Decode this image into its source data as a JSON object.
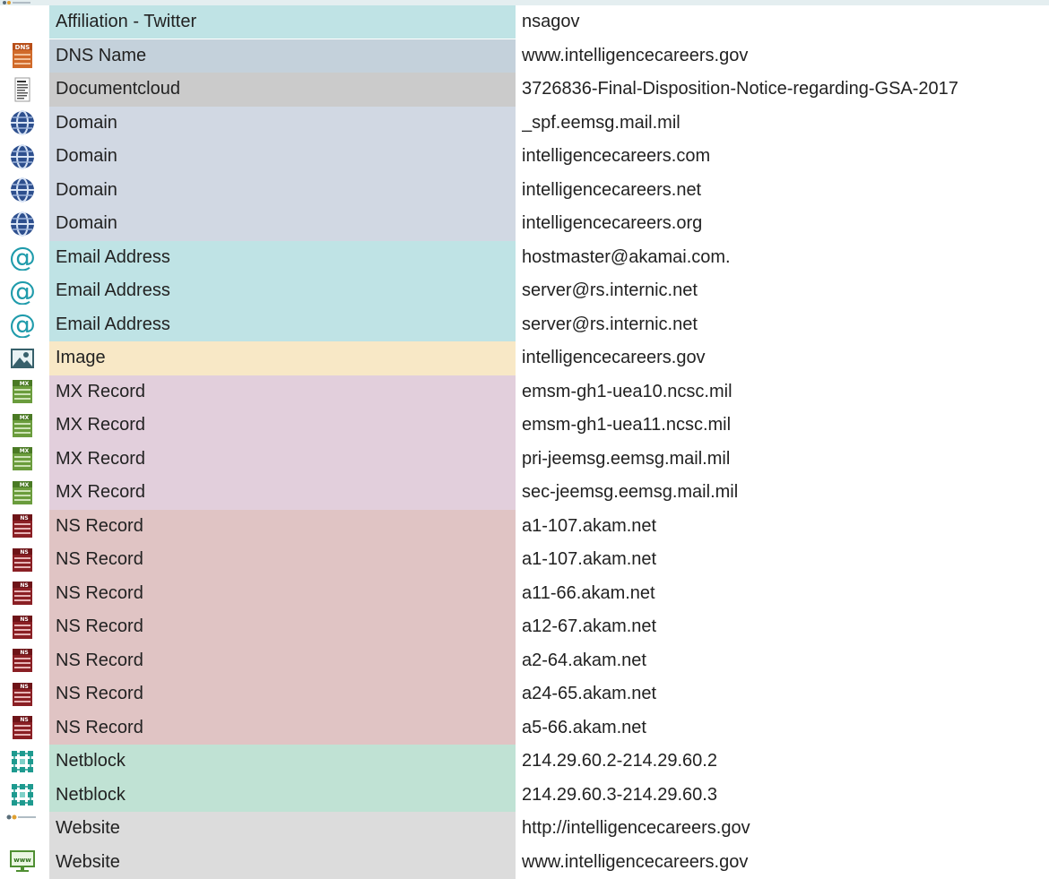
{
  "colors": {
    "twitter": "#bfe3e5",
    "dns": "#c4d1db",
    "document": "#cbcbcb",
    "domain": "#d1d8e3",
    "email": "#bfe3e5",
    "image": "#f8e8c6",
    "mx": "#e2cfdc",
    "ns": "#e0c4c4",
    "netblock": "#c0e2d4",
    "website": "#dcdcdc"
  },
  "rows": [
    {
      "icon": "twitter-affiliation-icon",
      "type": "Affiliation - Twitter",
      "value": "nsagov",
      "color": "twitter"
    },
    {
      "icon": "dns-name-icon",
      "type": "DNS Name",
      "value": "www.intelligencecareers.gov",
      "color": "dns"
    },
    {
      "icon": "document-icon",
      "type": "Documentcloud",
      "value": "3726836-Final-Disposition-Notice-regarding-GSA-2017",
      "color": "document"
    },
    {
      "icon": "globe-icon",
      "type": "Domain",
      "value": "_spf.eemsg.mail.mil",
      "color": "domain"
    },
    {
      "icon": "globe-icon",
      "type": "Domain",
      "value": "intelligencecareers.com",
      "color": "domain"
    },
    {
      "icon": "globe-icon",
      "type": "Domain",
      "value": "intelligencecareers.net",
      "color": "domain"
    },
    {
      "icon": "globe-icon",
      "type": "Domain",
      "value": "intelligencecareers.org",
      "color": "domain"
    },
    {
      "icon": "at-sign-icon",
      "type": "Email Address",
      "value": "hostmaster@akamai.com.",
      "color": "email"
    },
    {
      "icon": "at-sign-icon",
      "type": "Email Address",
      "value": "server@rs.internic.net",
      "color": "email"
    },
    {
      "icon": "at-sign-icon",
      "type": "Email Address",
      "value": "server@rs.internic.net",
      "color": "email"
    },
    {
      "icon": "image-icon",
      "type": "Image",
      "value": "intelligencecareers.gov",
      "color": "image"
    },
    {
      "icon": "mx-server-icon",
      "type": "MX Record",
      "value": "emsm-gh1-uea10.ncsc.mil",
      "color": "mx"
    },
    {
      "icon": "mx-server-icon",
      "type": "MX Record",
      "value": "emsm-gh1-uea11.ncsc.mil",
      "color": "mx"
    },
    {
      "icon": "mx-server-icon",
      "type": "MX Record",
      "value": "pri-jeemsg.eemsg.mail.mil",
      "color": "mx"
    },
    {
      "icon": "mx-server-icon",
      "type": "MX Record",
      "value": "sec-jeemsg.eemsg.mail.mil",
      "color": "mx"
    },
    {
      "icon": "ns-server-icon",
      "type": "NS Record",
      "value": "a1-107.akam.net",
      "color": "ns"
    },
    {
      "icon": "ns-server-icon",
      "type": "NS Record",
      "value": "a1-107.akam.net",
      "color": "ns"
    },
    {
      "icon": "ns-server-icon",
      "type": "NS Record",
      "value": "a11-66.akam.net",
      "color": "ns"
    },
    {
      "icon": "ns-server-icon",
      "type": "NS Record",
      "value": "a12-67.akam.net",
      "color": "ns"
    },
    {
      "icon": "ns-server-icon",
      "type": "NS Record",
      "value": "a2-64.akam.net",
      "color": "ns"
    },
    {
      "icon": "ns-server-icon",
      "type": "NS Record",
      "value": "a24-65.akam.net",
      "color": "ns"
    },
    {
      "icon": "ns-server-icon",
      "type": "NS Record",
      "value": "a5-66.akam.net",
      "color": "ns"
    },
    {
      "icon": "netblock-icon",
      "type": "Netblock",
      "value": "214.29.60.2-214.29.60.2",
      "color": "netblock"
    },
    {
      "icon": "netblock-icon",
      "type": "Netblock",
      "value": "214.29.60.3-214.29.60.3",
      "color": "netblock"
    },
    {
      "icon": "website-small-icon",
      "type": "Website",
      "value": "http://intelligencecareers.gov",
      "color": "website"
    },
    {
      "icon": "www-monitor-icon",
      "type": "Website",
      "value": "www.intelligencecareers.gov",
      "color": "website"
    }
  ]
}
